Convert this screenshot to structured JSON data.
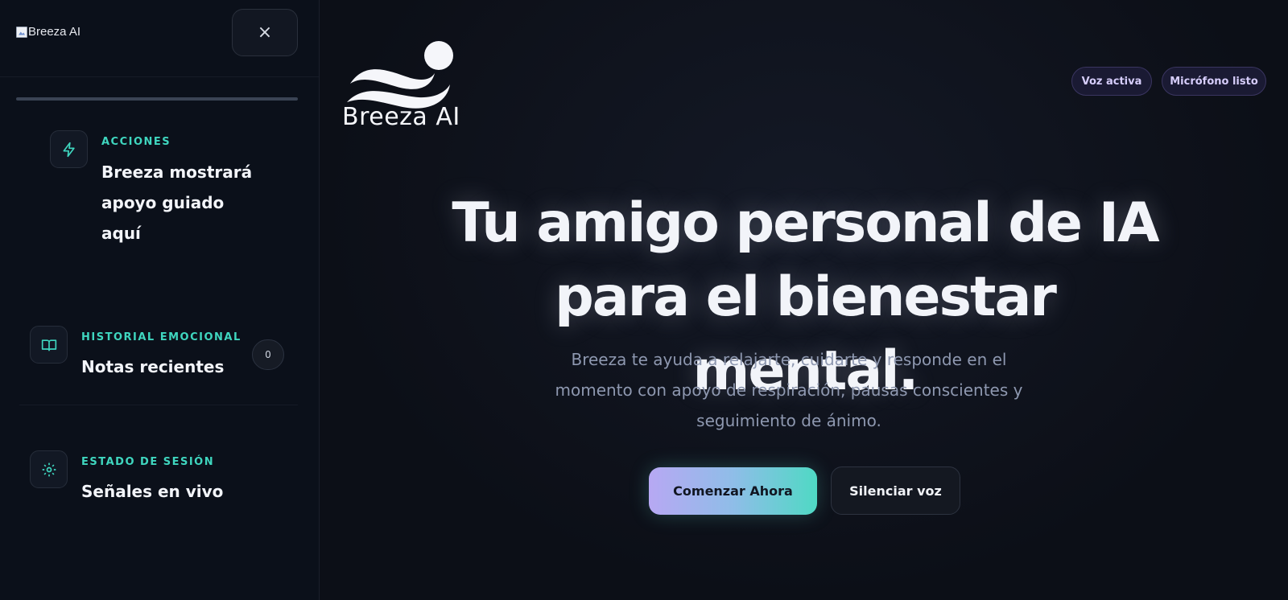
{
  "sidebar": {
    "logo_text": "Breeza AI",
    "close_symbol": "×",
    "cards": [
      {
        "icon": "lightning-icon",
        "eyebrow": "ACCIONES",
        "title_lines": [
          "Breeza mostrará",
          "apoyo guiado",
          "aquí"
        ]
      },
      {
        "icon": "book-icon",
        "eyebrow": "HISTORIAL EMOCIONAL",
        "title": "Notas recientes",
        "count": "0"
      },
      {
        "icon": "gear-icon",
        "eyebrow": "ESTADO DE SESIÓN",
        "title": "Señales en vivo"
      }
    ]
  },
  "main": {
    "brand_name": "Breeza AI",
    "pills": [
      "Voz activa",
      "Micrófono listo"
    ],
    "hero_lines": [
      "Tu amigo personal de IA",
      "para el bienestar mental."
    ],
    "subtitle_lines": [
      "Breeza te ayuda a relajarte, cuidarte y responde en el",
      "momento con apoyo de respiración, pausas conscientes y",
      "seguimiento de ánimo."
    ],
    "primary_button": "Comenzar Ahora",
    "secondary_button": "Silenciar voz"
  },
  "colors": {
    "accent_teal": "#3fd6bf",
    "accent_purple": "#b7a8f3",
    "background": "#0c0f17"
  }
}
